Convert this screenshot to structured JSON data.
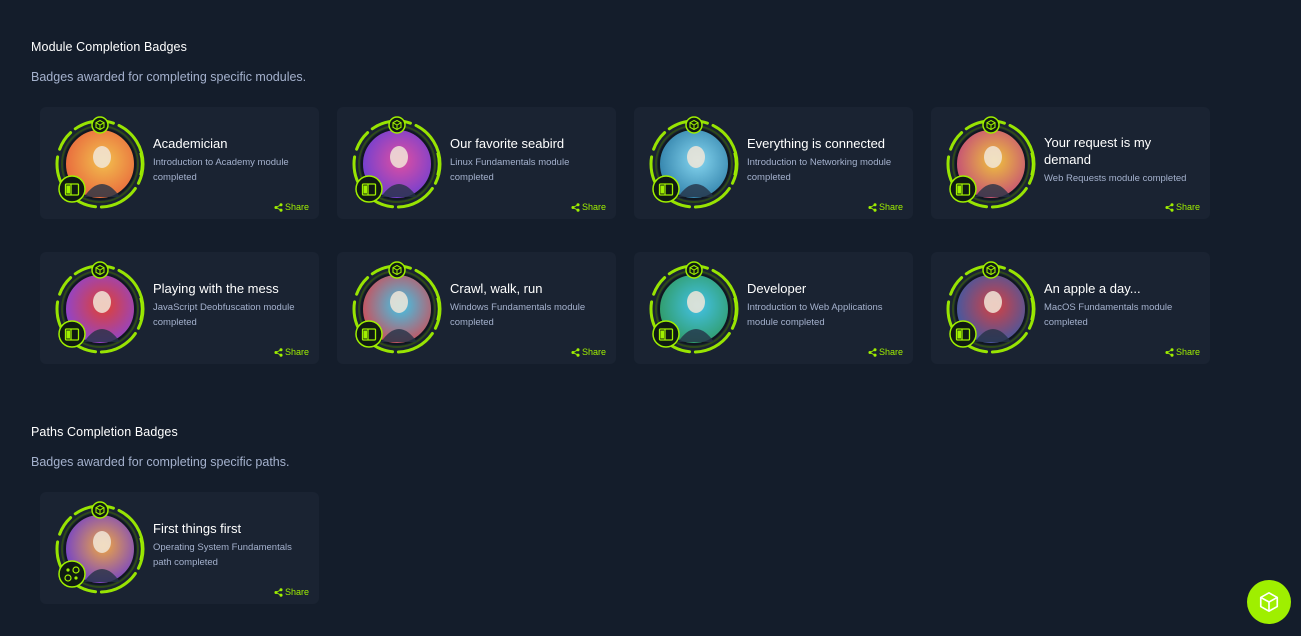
{
  "module_section": {
    "title": "Module Completion Badges",
    "subtitle": "Badges awarded for completing specific modules."
  },
  "paths_section": {
    "title": "Paths Completion Badges",
    "subtitle": "Badges awarded for completing specific paths."
  },
  "share_label": "Share",
  "module_badges": [
    {
      "title": "Academician",
      "description": "Introduction to Academy module completed",
      "icon": "scholar-hooded-figure-icon",
      "bg": "#e8643c",
      "glow": "#f2c14e",
      "corner_icon": "module-icon"
    },
    {
      "title": "Our favorite seabird",
      "description": "Linux Fundamentals module completed",
      "icon": "penguin-icon",
      "bg": "#6a3fd4",
      "glow": "#e14fa0",
      "corner_icon": "module-icon"
    },
    {
      "title": "Everything is connected",
      "description": "Introduction to Networking module completed",
      "icon": "network-hologram-icon",
      "bg": "#2f7fa8",
      "glow": "#86d6f0",
      "corner_icon": "module-icon"
    },
    {
      "title": "Your request is my demand",
      "description": "Web Requests module completed",
      "icon": "genie-icon",
      "bg": "#c2497a",
      "glow": "#f0c33c",
      "corner_icon": "module-icon"
    },
    {
      "title": "Playing with the mess",
      "description": "JavaScript Deobfuscation module completed",
      "icon": "cat-yarn-icon",
      "bg": "#8a45d8",
      "glow": "#e2412f",
      "corner_icon": "module-icon"
    },
    {
      "title": "Crawl, walk, run",
      "description": "Windows Fundamentals module completed",
      "icon": "robot-icon",
      "bg": "#d24a54",
      "glow": "#3fc5e8",
      "corner_icon": "module-icon"
    },
    {
      "title": "Developer",
      "description": "Introduction to Web Applications module completed",
      "icon": "developer-screens-icon",
      "bg": "#2f9a62",
      "glow": "#44c2e8",
      "corner_icon": "module-icon"
    },
    {
      "title": "An apple a day...",
      "description": "MacOS Fundamentals module completed",
      "icon": "apple-warrior-icon",
      "bg": "#3a5aa8",
      "glow": "#d64040",
      "corner_icon": "module-icon"
    }
  ],
  "path_badges": [
    {
      "title": "First things first",
      "description": "Operating System Fundamentals path completed",
      "icon": "student-graduate-icon",
      "bg": "#6e3ed0",
      "glow": "#f0a840",
      "corner_icon": "path-icon"
    }
  ]
}
